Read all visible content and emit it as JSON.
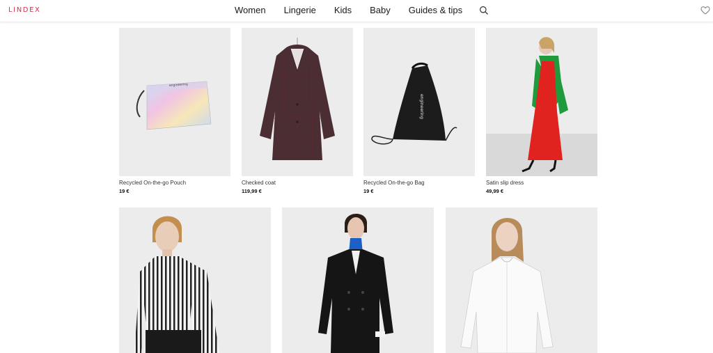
{
  "brand": {
    "logo_text": "LINDEX",
    "accent": "#d3324e"
  },
  "nav": {
    "items": [
      "Women",
      "Lingerie",
      "Kids",
      "Baby",
      "Guides & tips"
    ],
    "search_icon": "search-icon",
    "wishlist_icon": "heart-icon"
  },
  "products_row1": [
    {
      "name": "Recycled On-the-go Pouch",
      "price": "19 €"
    },
    {
      "name": "Checked coat",
      "price": "119,99 €"
    },
    {
      "name": "Recycled On-the-go Bag",
      "price": "19 €"
    },
    {
      "name": "Satin slip dress",
      "price": "49,99 €"
    }
  ],
  "products_row2": [
    {
      "image": "Striped shirt"
    },
    {
      "image": "Black double-breasted coat"
    },
    {
      "image": "White ruffle blouse"
    }
  ],
  "colors": {
    "tile_bg": "#ececec",
    "coat": "#4a2e33",
    "dress": "#e0231f",
    "jacket": "#1f9a3c",
    "bag": "#1c1c1c"
  }
}
